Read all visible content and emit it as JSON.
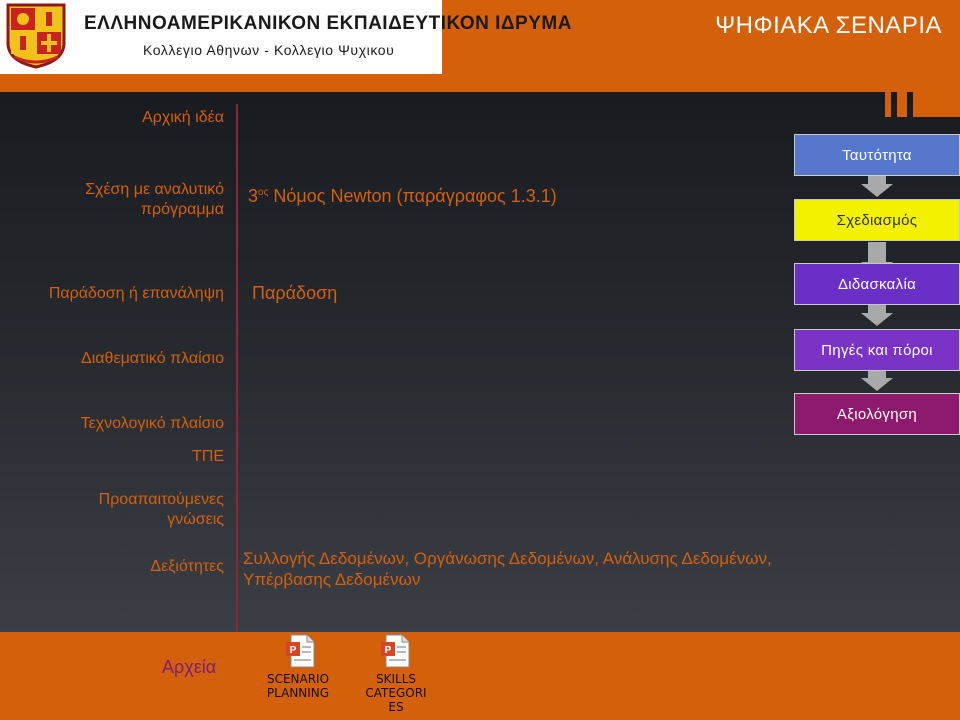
{
  "header": {
    "org_title": "ΕΛΛΗΝΟΑΜΕΡΙΚΑΝΙΚΟΝ ΕΚΠΑΙΔΕΥΤΙΚΟΝ ΙΔΡΥΜΑ",
    "org_subtitle": "Κολλεγιο Αθηνων - Κολλεγιο Ψυχικου",
    "site_title": "ΨΗΦΙΑΚΑ ΣΕΝΑΡΙΑ",
    "logo_icon": "crest-icon"
  },
  "fields": {
    "initial_idea": {
      "label": "Αρχική ιδέα",
      "value": ""
    },
    "curriculum": {
      "label_line1": "Σχέση με αναλυτικό",
      "label_line2": "πρόγραμμα",
      "value_pre": "3",
      "value_sup": "ος",
      "value_post": " Νόμος Newton (παράγραφος 1.3.1)"
    },
    "tradition": {
      "label": "Παράδοση ή επανάληψη",
      "value": "Παράδοση"
    },
    "interdisciplinary": {
      "label": "Διαθεματικό πλαίσιο",
      "value": ""
    },
    "technology": {
      "label": "Τεχνολογικό πλαίσιο",
      "value": ""
    },
    "ict": {
      "label": "ΤΠΕ",
      "value": ""
    },
    "prerequisites": {
      "label_line1": "Προαπαιτούμενες",
      "label_line2": "γνώσεις",
      "value": ""
    },
    "skills": {
      "label": "Δεξιότητες",
      "value_line1": "Συλλογής Δεδομένων, Οργάνωσης Δεδομένων, Ανάλυσης Δεδομένων,",
      "value_line2": "Υπέρβασης Δεδομένων"
    }
  },
  "flow": [
    {
      "label": "Ταυτότητα",
      "bg": "#5578cc",
      "fg": "#ffffff"
    },
    {
      "label": "Σχεδιασμός",
      "bg": "#f2f200",
      "fg": "#333333"
    },
    {
      "label": "Διδασκαλία",
      "bg": "#6a2fc6",
      "fg": "#ffffff"
    },
    {
      "label": "Πηγές και πόροι",
      "bg": "#7a33c4",
      "fg": "#ffffff"
    },
    {
      "label": "Αξιολόγηση",
      "bg": "#8d1a6d",
      "fg": "#ffffff"
    }
  ],
  "footer": {
    "label": "Αρχεία",
    "files": [
      {
        "line1": "SCENARIO",
        "line2": "PLANNING",
        "icon": "powerpoint-file-icon"
      },
      {
        "line1": "SKILLS CATEGORI",
        "line2": "ES",
        "icon": "powerpoint-file-icon"
      }
    ]
  },
  "colors": {
    "accent_orange": "#d4600a",
    "label_text": "#d4600a",
    "footer_label": "#7a1f70",
    "divider": "#8a2a2e"
  }
}
